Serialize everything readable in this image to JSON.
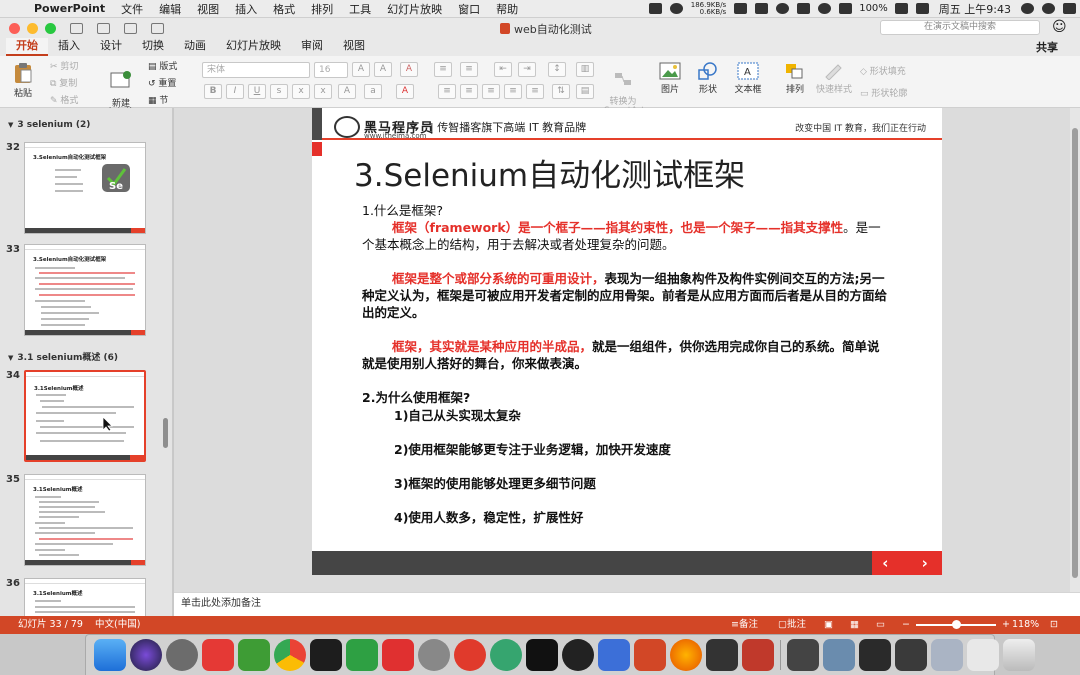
{
  "menubar": {
    "app": "PowerPoint",
    "items": [
      "文件",
      "编辑",
      "视图",
      "插入",
      "格式",
      "排列",
      "工具",
      "幻灯片放映",
      "窗口",
      "帮助"
    ],
    "net_up": "186.9KB/s",
    "net_down": "0.6KB/s",
    "battery": "100%",
    "clock": "周五 上午9:43"
  },
  "window": {
    "title": "web自动化测试",
    "search_placeholder": "在演示文稿中搜索",
    "share": "共享"
  },
  "tabs": [
    "开始",
    "插入",
    "设计",
    "切换",
    "动画",
    "幻灯片放映",
    "审阅",
    "视图"
  ],
  "ribbon": {
    "paste": "粘贴",
    "cut": "剪切",
    "copy": "复制",
    "format": "格式",
    "new_slide": "新建\n幻灯片",
    "layout": "版式",
    "reset": "重置",
    "section": "节",
    "font_name": "宋体",
    "font_size": "16",
    "convert": "转换为\nSmartArt",
    "picture": "图片",
    "shape": "形状",
    "textbox": "文本框",
    "arrange": "排列",
    "quick_styles": "快速样式",
    "shape_fill": "形状填充",
    "shape_outline": "形状轮廓"
  },
  "sidebar": {
    "section1": "3 selenium (2)",
    "section2": "3.1 selenium概述 (6)",
    "slides": [
      {
        "num": "32",
        "title": "3.Selenium自动化测试框架"
      },
      {
        "num": "33",
        "title": "3.Selenium自动化测试框架"
      },
      {
        "num": "34",
        "title": "3.1Selenium概述"
      },
      {
        "num": "35",
        "title": "3.1Selenium概述"
      },
      {
        "num": "36",
        "title": "3.1Selenium概述"
      }
    ]
  },
  "slide": {
    "logo_name": "黑马程序员",
    "logo_url": "www.itheima.com",
    "tagline": "| 传智播客旗下高端 IT 教育品牌",
    "tagline_right": "改变中国 IT 教育，我们正在行动",
    "title": "3.Selenium自动化测试框架",
    "q1": "1.什么是框架?",
    "p1_red": "框架（framework）是一个框子——指其约束性，也是一个架子——指其支撑性",
    "p1_rest": "。是一个基本概念上的结构，用于去解决或者处理复杂的问题。",
    "p2_red": "框架是整个或部分系统的可重用设计，",
    "p2_rest": "表现为一组抽象构件及构件实例间交互的方法;另一种定义认为，框架是可被应用开发者定制的应用骨架。前者是从应用方面而后者是从目的方面给出的定义。",
    "p3_red": "框架，其实就是某种应用的半成品，",
    "p3_rest": "就是一组组件，供你选用完成你自己的系统。简单说就是使用别人搭好的舞台，你来做表演。",
    "q2": "2.为什么使用框架?",
    "reasons": [
      "1)自己从头实现太复杂",
      "2)使用框架能够更专注于业务逻辑，加快开发速度",
      "3)框架的使用能够处理更多细节问题",
      "4)使用人数多，稳定性，扩展性好"
    ],
    "nav": "‹ ›"
  },
  "notes_placeholder": "单击此处添加备注",
  "status": {
    "slide_count": "幻灯片 33 / 79",
    "language": "中文(中国)",
    "notes": "备注",
    "comments": "批注",
    "zoom": "118%"
  }
}
